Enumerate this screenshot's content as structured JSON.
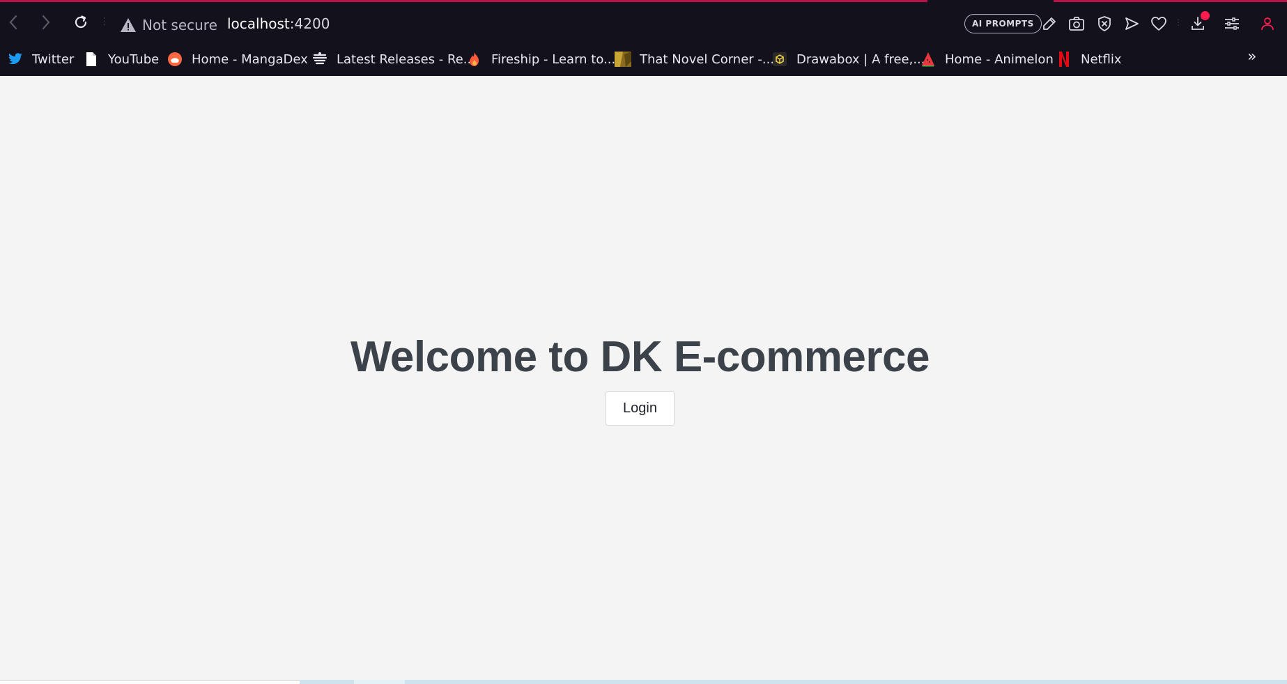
{
  "browser": {
    "security_label": "Not secure",
    "url_host": "localhost",
    "url_port": ":4200",
    "ai_prompts_label": "AI PROMPTS",
    "accent_color": "#ff1c4f",
    "toolbar_icons": [
      "edit-icon",
      "camera-icon",
      "shield-x-icon",
      "send-icon",
      "heart-icon",
      "download-icon",
      "settings-sliders-icon",
      "profile-icon"
    ]
  },
  "bookmarks": {
    "items": [
      {
        "label": "Twitter",
        "icon": "twitter-icon"
      },
      {
        "label": "YouTube",
        "icon": "page-icon"
      },
      {
        "label": "Home - MangaDex",
        "icon": "mangadex-icon"
      },
      {
        "label": "Latest Releases - Re...",
        "icon": "site-icon"
      },
      {
        "label": "Fireship - Learn to...",
        "icon": "fire-icon"
      },
      {
        "label": "That Novel Corner -...",
        "icon": "novel-icon"
      },
      {
        "label": "Drawabox | A free,...",
        "icon": "drawabox-icon"
      },
      {
        "label": "Home - Animelon",
        "icon": "watermelon-icon"
      },
      {
        "label": "Netflix",
        "icon": "netflix-icon"
      }
    ],
    "more_label": "»"
  },
  "page": {
    "title": "Welcome to DK E-commerce",
    "login_label": "Login"
  }
}
